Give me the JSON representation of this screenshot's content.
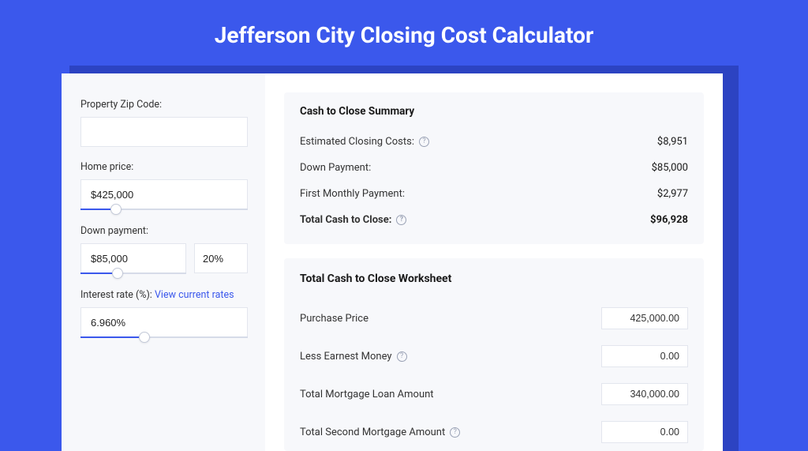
{
  "title": "Jefferson City Closing Cost Calculator",
  "form": {
    "zip_label": "Property Zip Code:",
    "zip_value": "",
    "home_price_label": "Home price:",
    "home_price_value": "$425,000",
    "home_price_slider_pct": 18,
    "down_label": "Down payment:",
    "down_value": "$85,000",
    "down_pct_value": "20%",
    "down_slider_pct": 30,
    "rate_label": "Interest rate (%):",
    "rate_link_text": "View current rates",
    "rate_value": "6.960%",
    "rate_slider_pct": 35
  },
  "summary": {
    "heading": "Cash to Close Summary",
    "lines": [
      {
        "label": "Estimated Closing Costs:",
        "help": true,
        "value": "$8,951"
      },
      {
        "label": "Down Payment:",
        "help": false,
        "value": "$85,000"
      },
      {
        "label": "First Monthly Payment:",
        "help": false,
        "value": "$2,977"
      }
    ],
    "total_label": "Total Cash to Close:",
    "total_value": "$96,928"
  },
  "worksheet": {
    "heading": "Total Cash to Close Worksheet",
    "rows": [
      {
        "label": "Purchase Price",
        "help": false,
        "value": "425,000.00"
      },
      {
        "label": "Less Earnest Money",
        "help": true,
        "value": "0.00"
      },
      {
        "label": "Total Mortgage Loan Amount",
        "help": false,
        "value": "340,000.00"
      },
      {
        "label": "Total Second Mortgage Amount",
        "help": true,
        "value": "0.00"
      }
    ]
  }
}
